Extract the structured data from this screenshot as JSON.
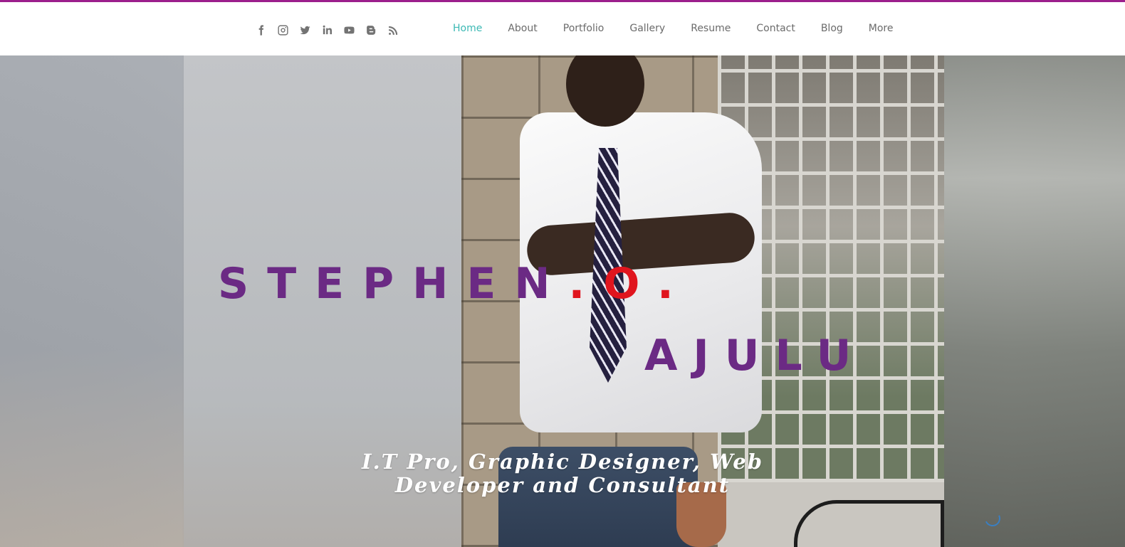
{
  "social": [
    {
      "name": "facebook-icon"
    },
    {
      "name": "instagram-icon"
    },
    {
      "name": "twitter-icon"
    },
    {
      "name": "linkedin-icon"
    },
    {
      "name": "youtube-icon"
    },
    {
      "name": "blogger-icon"
    },
    {
      "name": "rss-icon"
    }
  ],
  "nav": {
    "items": [
      "Home",
      "About",
      "Portfolio",
      "Gallery",
      "Resume",
      "Contact",
      "Blog",
      "More"
    ],
    "active": "Home",
    "active_color": "#3cb9b4"
  },
  "hero": {
    "name_first": "STEPHEN",
    "name_sep1": ".",
    "name_initial": "O",
    "name_sep2": ".",
    "name_last": "AJULU",
    "tagline": "I.T Pro, Graphic Designer, Web Developer and Consultant",
    "name_color": "#6b2a84",
    "accent_color": "#e0151e"
  },
  "colors": {
    "top_accent": "#9c1f8c"
  }
}
